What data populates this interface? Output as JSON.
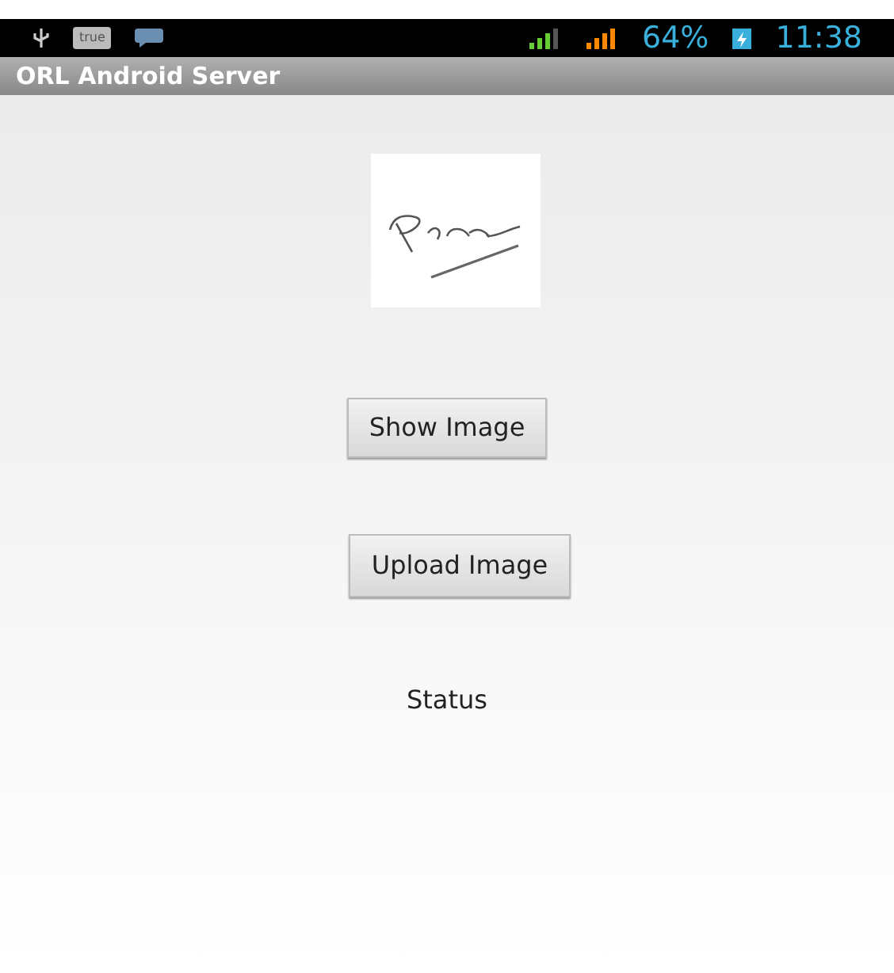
{
  "status_bar": {
    "battery": "64%",
    "time": "11:38",
    "notification": "true"
  },
  "app_bar": {
    "title": "ORL Android Server"
  },
  "buttons": [
    "Show Image",
    "Upload Image"
  ],
  "status": "Status"
}
